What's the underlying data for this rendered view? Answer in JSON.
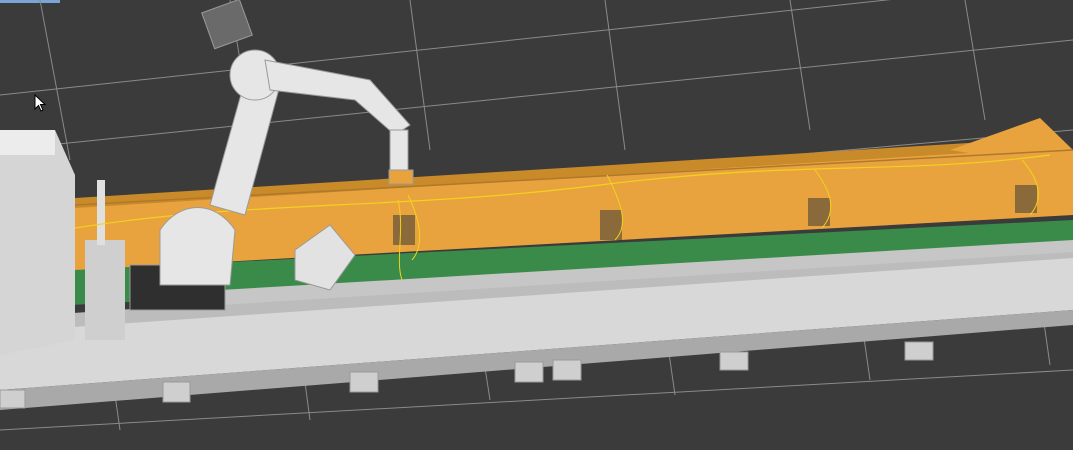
{
  "viewport": {
    "background": "#3b3b3b",
    "grid_color": "#8a8a8a"
  },
  "scene": {
    "rail_color": "#e8a33f",
    "floor_color": "#3a8a4a",
    "machine_color": "#d8d8d8",
    "robot_color": "#e6e6e6",
    "weld_path_color": "#f2d21e",
    "fixture_count": 4
  },
  "icons": {
    "cursor": "mouse-pointer-icon"
  }
}
